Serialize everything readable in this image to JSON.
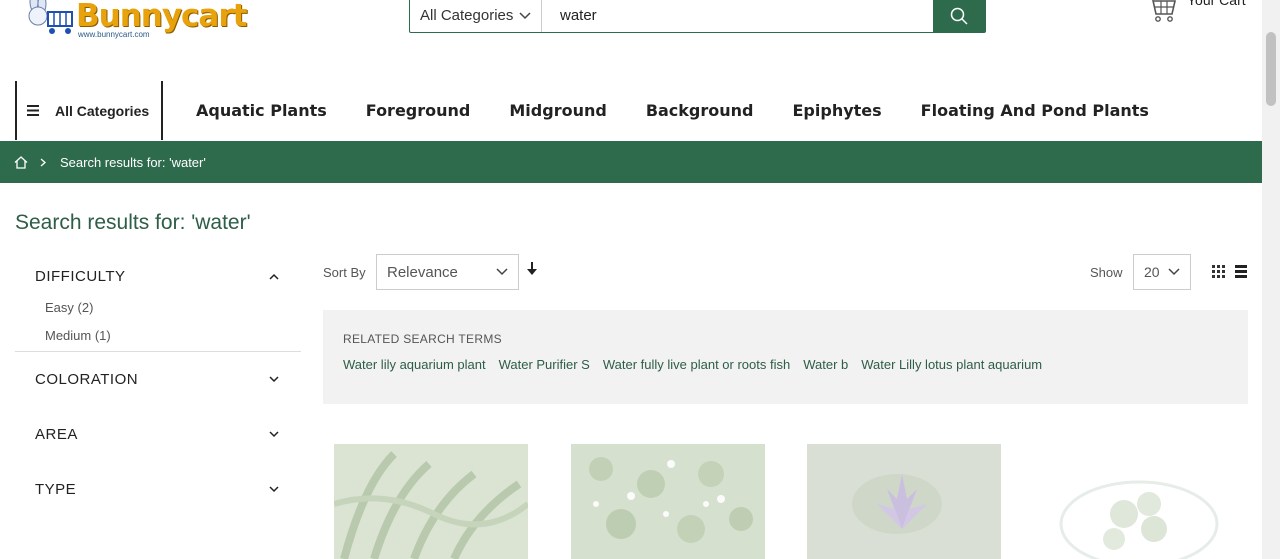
{
  "logo": {
    "brand": "Bunnycart",
    "url": "www.bunnycart.com"
  },
  "search": {
    "category": "All Categories",
    "query": "water"
  },
  "cart": {
    "label": "Your Cart"
  },
  "nav": {
    "all_categories": "All Categories",
    "links": [
      "Aquatic Plants",
      "Foreground",
      "Midground",
      "Background",
      "Epiphytes",
      "Floating And Pond Plants"
    ]
  },
  "breadcrumb": {
    "current": "Search results for: 'water'"
  },
  "page_title": "Search results for: 'water'",
  "filters": {
    "difficulty": {
      "title": "DIFFICULTY",
      "options": [
        "Easy (2)",
        "Medium (1)"
      ]
    },
    "coloration": {
      "title": "COLORATION"
    },
    "area": {
      "title": "AREA"
    },
    "type": {
      "title": "TYPE"
    }
  },
  "toolbar": {
    "sort_label": "Sort By",
    "sort_value": "Relevance",
    "show_label": "Show",
    "show_value": "20"
  },
  "related": {
    "title": "RELATED SEARCH TERMS",
    "terms": [
      "Water lily aquarium plant",
      "Water Purifier S",
      "Water fully live plant or roots fish",
      "Water b",
      "Water Lilly lotus plant aquarium"
    ]
  },
  "colors": {
    "brand_green": "#2e6b4d",
    "logo_orange": "#e8a20c"
  },
  "icons": [
    "bunny-logo-icon",
    "chevron-down-icon",
    "search-icon",
    "cart-icon",
    "menu-icon",
    "home-icon",
    "chevron-right-icon",
    "chevron-up-icon",
    "arrow-down-icon",
    "grid-icon",
    "list-icon"
  ]
}
